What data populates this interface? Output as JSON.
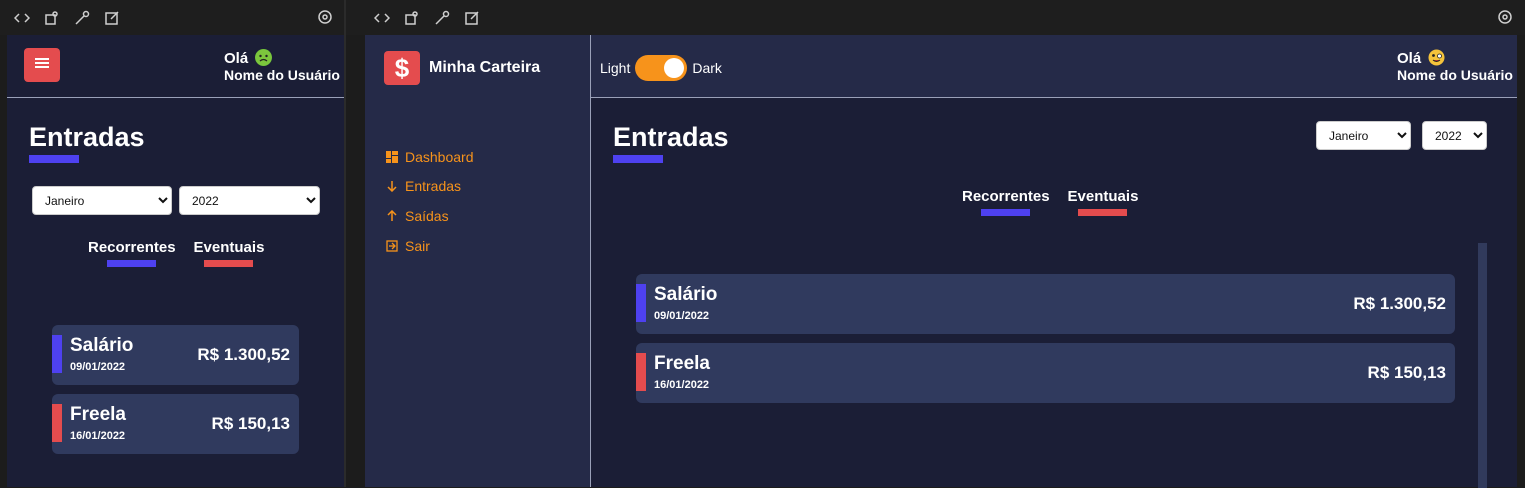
{
  "mobile": {
    "greeting": "Olá",
    "greeting_emoji": "nauseated-face-emoji",
    "username": "Nome do Usuário",
    "title": "Entradas",
    "month_selected": "Janeiro",
    "year_selected": "2022",
    "tabs": [
      {
        "label": "Recorrentes",
        "color": "#4e41f0"
      },
      {
        "label": "Eventuais",
        "color": "#e44c4e"
      }
    ],
    "items": [
      {
        "title": "Salário",
        "date": "09/01/2022",
        "amount": "R$ 1.300,52",
        "color": "#4e41f0"
      },
      {
        "title": "Freela",
        "date": "16/01/2022",
        "amount": "R$ 150,13",
        "color": "#e44c4e"
      }
    ]
  },
  "desktop": {
    "brand": "Minha Carteira",
    "brand_icon": "$",
    "nav": [
      {
        "label": "Dashboard",
        "icon": "dashboard-icon"
      },
      {
        "label": "Entradas",
        "icon": "arrow-down-icon"
      },
      {
        "label": "Saídas",
        "icon": "arrow-up-icon"
      },
      {
        "label": "Sair",
        "icon": "exit-icon"
      }
    ],
    "theme_light": "Light",
    "theme_dark": "Dark",
    "greeting": "Olá",
    "greeting_emoji": "zany-face-emoji",
    "username": "Nome do Usuário",
    "title": "Entradas",
    "month_selected": "Janeiro",
    "year_selected": "2022",
    "tabs": [
      {
        "label": "Recorrentes",
        "color": "#4e41f0"
      },
      {
        "label": "Eventuais",
        "color": "#e44c4e"
      }
    ],
    "items": [
      {
        "title": "Salário",
        "date": "09/01/2022",
        "amount": "R$ 1.300,52",
        "color": "#4e41f0"
      },
      {
        "title": "Freela",
        "date": "16/01/2022",
        "amount": "R$ 150,13",
        "color": "#e44c4e"
      }
    ]
  },
  "colors": {
    "accent_orange": "#f7931b",
    "accent_red": "#e44c4e",
    "accent_blue": "#4e41f0",
    "bg": "#1b1e36",
    "card": "#303a5e"
  }
}
